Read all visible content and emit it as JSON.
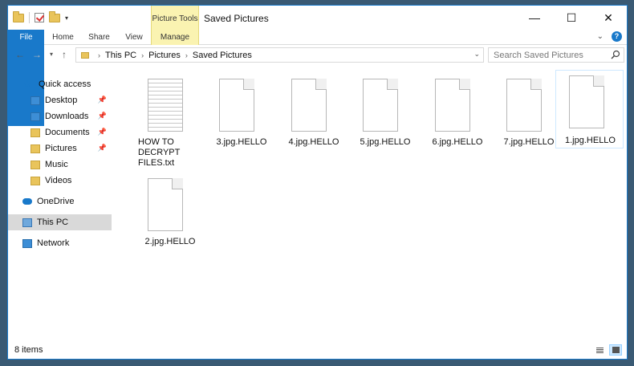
{
  "window": {
    "title": "Saved Pictures",
    "contextual_group": "Picture Tools",
    "controls": {
      "minimize": "—",
      "maximize": "☐",
      "close": "✕"
    }
  },
  "ribbon": {
    "tabs": [
      "File",
      "Home",
      "Share",
      "View",
      "Manage"
    ],
    "expand_icon": "chevron-down-icon",
    "help_label": "?"
  },
  "address": {
    "crumbs": [
      "This PC",
      "Pictures",
      "Saved Pictures"
    ],
    "search_placeholder": "Search Saved Pictures"
  },
  "nav": {
    "quick_access": "Quick access",
    "items": [
      {
        "label": "Desktop",
        "pinned": true
      },
      {
        "label": "Downloads",
        "pinned": true
      },
      {
        "label": "Documents",
        "pinned": true
      },
      {
        "label": "Pictures",
        "pinned": true
      },
      {
        "label": "Music",
        "pinned": false
      },
      {
        "label": "Videos",
        "pinned": false
      }
    ],
    "onedrive": "OneDrive",
    "this_pc": "This PC",
    "network": "Network"
  },
  "files": [
    {
      "name": "HOW TO DECRYPT FILES.txt",
      "kind": "txt"
    },
    {
      "name": "3.jpg.HELLO",
      "kind": "blank"
    },
    {
      "name": "4.jpg.HELLO",
      "kind": "blank"
    },
    {
      "name": "5.jpg.HELLO",
      "kind": "blank"
    },
    {
      "name": "6.jpg.HELLO",
      "kind": "blank"
    },
    {
      "name": "7.jpg.HELLO",
      "kind": "blank"
    },
    {
      "name": "1.jpg.HELLO",
      "kind": "blank"
    },
    {
      "name": "2.jpg.HELLO",
      "kind": "blank"
    }
  ],
  "status": {
    "item_count": "8 items"
  },
  "colors": {
    "accent": "#1979ca",
    "manage_tab": "#faf3b1",
    "selected_nav": "#d9d9d9"
  }
}
